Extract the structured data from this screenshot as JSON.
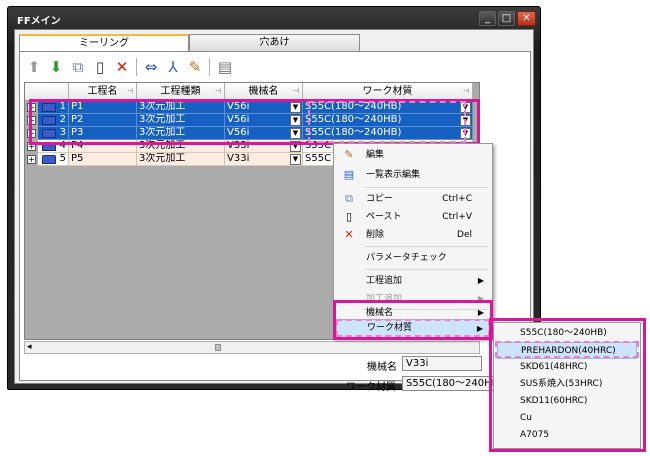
{
  "window": {
    "title": "FFメイン",
    "minimize": "_",
    "maximize": "□",
    "close": "✕"
  },
  "tabs": [
    {
      "label": "ミーリング"
    },
    {
      "label": "穴あけ"
    }
  ],
  "toolbar": {
    "icons": [
      "up-arrow-icon",
      "down-arrow-icon",
      "copy-icon",
      "paste-icon",
      "delete-icon",
      "rename-icon",
      "axis-icon",
      "edit-icon",
      "database-icon"
    ],
    "glyphs": [
      "⬆",
      "⬇",
      "⧉",
      "▯",
      "✕",
      "⇔",
      "⅄",
      "✎",
      "▤"
    ],
    "colors": {
      "up": "#9a9a9a",
      "down": "#2a9a2a",
      "delete": "#d02010"
    }
  },
  "grid": {
    "columns": [
      "工程名",
      "工程種類",
      "機械名",
      "ワーク材質"
    ],
    "pin_glyph": "⊣",
    "expander": "+",
    "dropdown": "▼",
    "rows": [
      {
        "num": "1",
        "name": "P1",
        "type": "3次元加工",
        "machine": "V56i",
        "material": "S55C(180～240HB)",
        "selected": true
      },
      {
        "num": "2",
        "name": "P2",
        "type": "3次元加工",
        "machine": "V56i",
        "material": "S55C(180～240HB)",
        "selected": true
      },
      {
        "num": "3",
        "name": "P3",
        "type": "3次元加工",
        "machine": "V56i",
        "material": "S55C(180～240HB)",
        "selected": true
      },
      {
        "num": "4",
        "name": "P4",
        "type": "3次元加工",
        "machine": "V33i",
        "material": "S55C",
        "selected": false
      },
      {
        "num": "5",
        "name": "P5",
        "type": "3次元加工",
        "machine": "V33i",
        "material": "S55C",
        "selected": false
      }
    ]
  },
  "scrollbar": {
    "left": "◂"
  },
  "properties": {
    "machine_label": "機械名",
    "machine_value": "V33i",
    "material_label": "ワーク材質",
    "material_value": "S55C(180～240HB)"
  },
  "context_menu": {
    "edit": "編集",
    "list_edit": "一覧表示編集",
    "copy": "コピー",
    "copy_key": "Ctrl+C",
    "paste": "ペースト",
    "paste_key": "Ctrl+V",
    "delete": "削除",
    "delete_key": "Del",
    "param_check": "パラメータチェック",
    "add_process": "工程追加",
    "add_machining": "加工追加",
    "machine_name": "機械名",
    "work_material": "ワーク材質",
    "submenu_arrow": "▶",
    "icons": {
      "edit": "✎",
      "list_edit": "▤",
      "copy": "⧉",
      "paste": "▯",
      "delete": "✕"
    }
  },
  "material_submenu": [
    "S55C(180～240HB)",
    "PREHARDON(40HRC)",
    "SKD61(48HRC)",
    "SUS系焼入(53HRC)",
    "SKD11(60HRC)",
    "Cu",
    "A7075"
  ],
  "highlight_color": "#d6189a"
}
